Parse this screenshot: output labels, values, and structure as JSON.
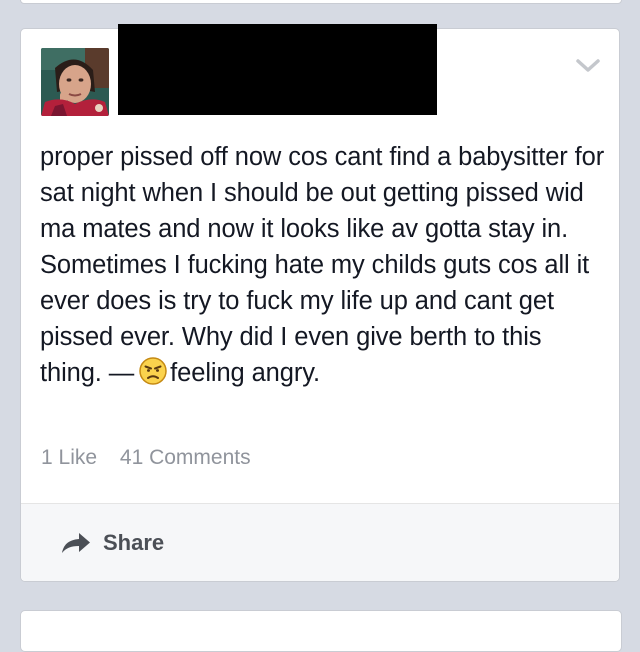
{
  "post": {
    "text": "proper pissed off now cos cant find a babysitter for sat night when I should be out getting pissed wid ma mates and now it looks like av gotta stay in. Sometimes I fucking hate my childs guts cos all it ever does is try to fuck my life up and cant get pissed ever. Why did I even give berth to this thing. —",
    "feeling": "feeling angry.",
    "feeling_icon": "angry-face-icon"
  },
  "stats": {
    "likes": "1 Like",
    "comments": "41 Comments"
  },
  "actions": {
    "share_label": "Share",
    "share_icon": "share-arrow-icon"
  },
  "header": {
    "avatar_icon": "profile-avatar",
    "menu_icon": "chevron-down-icon"
  },
  "colors": {
    "page_background": "#d6dae3",
    "card_background": "#ffffff",
    "body_text": "#141823",
    "meta_text": "#90949c",
    "action_bar": "#f6f7f9"
  }
}
